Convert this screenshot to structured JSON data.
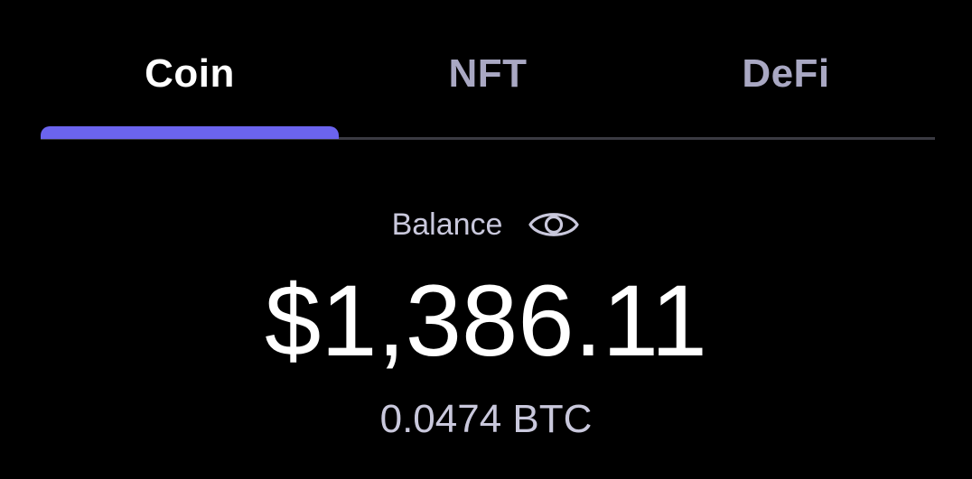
{
  "tabs": [
    {
      "label": "Coin",
      "active": true
    },
    {
      "label": "NFT",
      "active": false
    },
    {
      "label": "DeFi",
      "active": false
    }
  ],
  "balance": {
    "label": "Balance",
    "visibility_icon": "eye-icon",
    "amount": "$1,386.11",
    "crypto_amount": "0.0474 BTC"
  },
  "colors": {
    "background": "#000000",
    "accent": "#6b64ee",
    "text_primary": "#ffffff",
    "text_secondary": "#c9c8dc",
    "tab_inactive": "#a9a8c3"
  }
}
